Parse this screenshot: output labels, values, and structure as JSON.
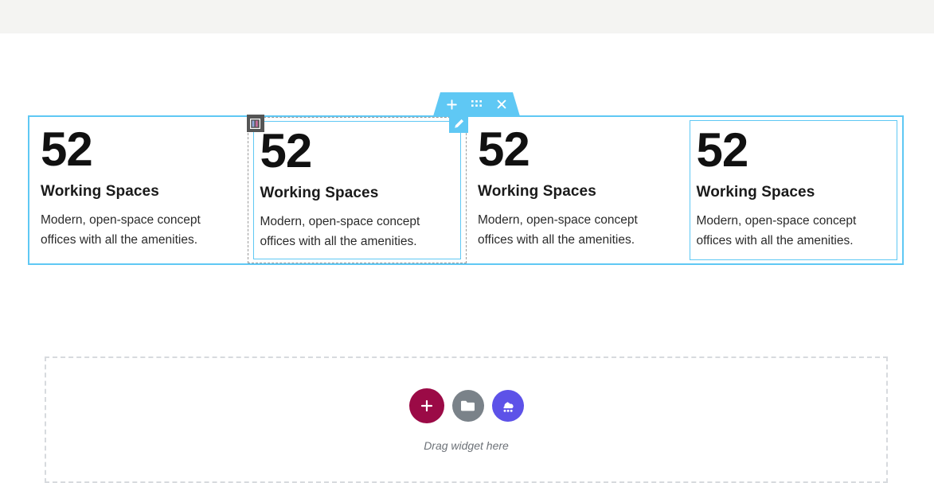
{
  "colors": {
    "accent_blue": "#5fc8f4",
    "topbar_bg": "#f4f4f2",
    "handle_gray": "#555555",
    "dropzone_border": "#d7dade",
    "add_button": "#9b0a46",
    "folder_button": "#7a8289",
    "ai_button": "#5d52e8",
    "number_color": "#111111"
  },
  "topbar": {
    "title": ""
  },
  "section": {
    "toolbar": {
      "add_label": "+",
      "drag_icon": "grid-dots-icon",
      "close_label": "×",
      "items": [
        {
          "name": "add-section-button",
          "icon": "plus-icon"
        },
        {
          "name": "drag-section-handle",
          "icon": "grid-dots-icon"
        },
        {
          "name": "delete-section-button",
          "icon": "close-icon"
        }
      ]
    },
    "columns": [
      {
        "state": "normal",
        "widget": {
          "selected": false,
          "number": "52",
          "title": "Working Spaces",
          "description": "Modern, open-space concept offices with all the amenities."
        }
      },
      {
        "state": "hover",
        "widget": {
          "selected": true,
          "handle_icon": "columns-layout-icon",
          "edit_icon": "pencil-icon",
          "number": "52",
          "title": "Working Spaces",
          "description": "Modern, open-space concept offices with all the amenities."
        }
      },
      {
        "state": "normal",
        "widget": {
          "selected": false,
          "number": "52",
          "title": "Working Spaces",
          "description": "Modern, open-space concept offices with all the amenities."
        }
      },
      {
        "state": "normal",
        "widget": {
          "selected": true,
          "number": "52",
          "title": "Working Spaces",
          "description": "Modern, open-space concept offices with all the amenities."
        }
      }
    ]
  },
  "dropzone": {
    "label": "Drag widget here",
    "buttons": [
      {
        "name": "add-widget-button",
        "icon": "plus-icon",
        "color": "#9b0a46"
      },
      {
        "name": "folder-button",
        "icon": "folder-icon",
        "color": "#7a8289"
      },
      {
        "name": "ai-builder-button",
        "icon": "ai-cloud-icon",
        "color": "#5d52e8"
      }
    ]
  }
}
